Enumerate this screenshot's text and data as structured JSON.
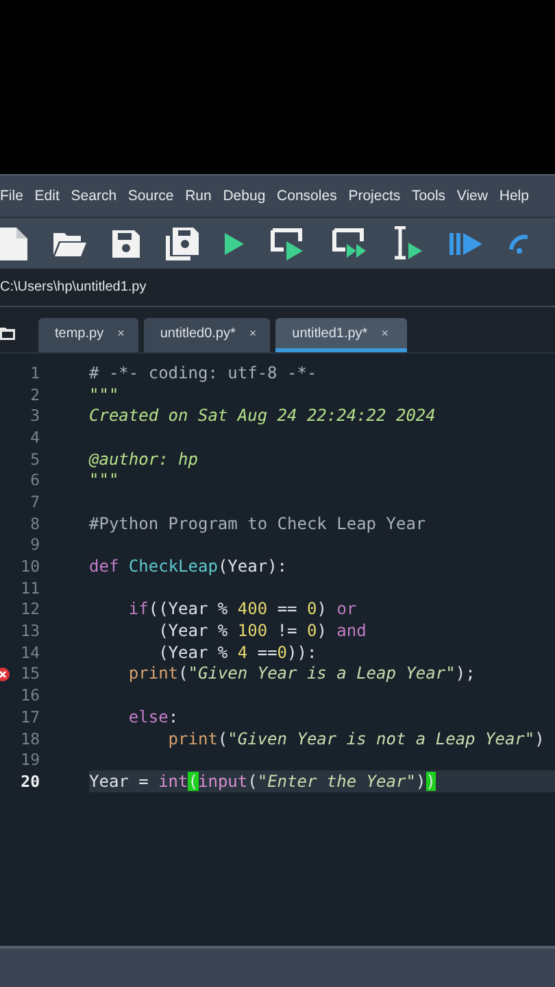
{
  "menu": [
    "File",
    "Edit",
    "Search",
    "Source",
    "Run",
    "Debug",
    "Consoles",
    "Projects",
    "Tools",
    "View",
    "Help"
  ],
  "path": "C:\\Users\\hp\\untitled1.py",
  "tabs": [
    {
      "label": "temp.py",
      "close": "×",
      "selected": false
    },
    {
      "label": "untitled0.py*",
      "close": "×",
      "selected": false
    },
    {
      "label": "untitled1.py*",
      "close": "×",
      "selected": true
    }
  ],
  "lines": [
    {
      "number": "1",
      "error": false,
      "current": false,
      "tokens": [
        {
          "kind": "comment",
          "text": "# -*- coding: utf-8 -*-"
        }
      ]
    },
    {
      "number": "2",
      "error": false,
      "current": false,
      "tokens": [
        {
          "kind": "docstring",
          "text": "\"\"\""
        }
      ]
    },
    {
      "number": "3",
      "error": false,
      "current": false,
      "tokens": [
        {
          "kind": "docstring",
          "text": "Created on Sat Aug 24 22:24:22 2024"
        }
      ]
    },
    {
      "number": "4",
      "error": false,
      "current": false
    },
    {
      "number": "5",
      "error": false,
      "current": false,
      "tokens": [
        {
          "kind": "docstring",
          "text": "@author: hp"
        }
      ]
    },
    {
      "number": "6",
      "error": false,
      "current": false,
      "tokens": [
        {
          "kind": "docstring",
          "text": "\"\"\""
        }
      ]
    },
    {
      "number": "7",
      "error": false,
      "current": false
    },
    {
      "number": "8",
      "error": false,
      "current": false,
      "tokens": [
        {
          "kind": "comment",
          "text": "#Python Program to Check Leap Year"
        }
      ]
    },
    {
      "number": "9",
      "error": false,
      "current": false
    },
    {
      "number": "10",
      "error": false,
      "current": false,
      "tokens": [
        {
          "kind": "keyword",
          "text": "def"
        },
        {
          "kind": "defname",
          "text": " CheckLeap"
        },
        {
          "kind": "plain",
          "text": "(Year):"
        }
      ]
    },
    {
      "number": "11",
      "error": false,
      "current": false
    },
    {
      "number": "12",
      "error": false,
      "current": false,
      "tokens": [
        {
          "kind": "keyword",
          "text": "    if"
        },
        {
          "kind": "plain",
          "text": "((Year % "
        },
        {
          "kind": "number",
          "text": "400"
        },
        {
          "kind": "plain",
          "text": " == "
        },
        {
          "kind": "number",
          "text": "0"
        },
        {
          "kind": "plain",
          "text": ") "
        },
        {
          "kind": "keyword",
          "text": "or"
        }
      ]
    },
    {
      "number": "13",
      "error": false,
      "current": false,
      "tokens": [
        {
          "kind": "plain",
          "text": "       (Year % "
        },
        {
          "kind": "number",
          "text": "100"
        },
        {
          "kind": "plain",
          "text": " != "
        },
        {
          "kind": "number",
          "text": "0"
        },
        {
          "kind": "plain",
          "text": ") "
        },
        {
          "kind": "keyword",
          "text": "and"
        }
      ]
    },
    {
      "number": "14",
      "error": false,
      "current": false,
      "tokens": [
        {
          "kind": "plain",
          "text": "       (Year % "
        },
        {
          "kind": "number",
          "text": "4"
        },
        {
          "kind": "plain",
          "text": " =="
        },
        {
          "kind": "number",
          "text": "0"
        },
        {
          "kind": "plain",
          "text": ")):"
        }
      ]
    },
    {
      "number": "15",
      "error": true,
      "current": false,
      "tokens": [
        {
          "kind": "builtin",
          "text": "    print"
        },
        {
          "kind": "plain",
          "text": "("
        },
        {
          "kind": "string",
          "text": "\"Given Year is a Leap Year\""
        },
        {
          "kind": "plain",
          "text": ");"
        }
      ]
    },
    {
      "number": "16",
      "error": false,
      "current": false
    },
    {
      "number": "17",
      "error": false,
      "current": false,
      "tokens": [
        {
          "kind": "keyword",
          "text": "    else"
        },
        {
          "kind": "plain",
          "text": ":"
        }
      ]
    },
    {
      "number": "18",
      "error": false,
      "current": false,
      "tokens": [
        {
          "kind": "builtin",
          "text": "        print"
        },
        {
          "kind": "plain",
          "text": "("
        },
        {
          "kind": "string",
          "text": "\"Given Year is not a Leap Year\""
        },
        {
          "kind": "plain",
          "text": ")"
        }
      ]
    },
    {
      "number": "19",
      "error": false,
      "current": false
    },
    {
      "number": "20",
      "error": false,
      "current": true,
      "tokens": [
        {
          "kind": "plain",
          "text": "Year = "
        },
        {
          "kind": "call",
          "text": "int"
        },
        {
          "kind": "match",
          "text": "("
        },
        {
          "kind": "call",
          "text": "input"
        },
        {
          "kind": "plain",
          "text": "("
        },
        {
          "kind": "string",
          "text": "\"Enter the Year\""
        },
        {
          "kind": "plain",
          "text": ")"
        },
        {
          "kind": "match",
          "text": ")"
        }
      ]
    }
  ]
}
